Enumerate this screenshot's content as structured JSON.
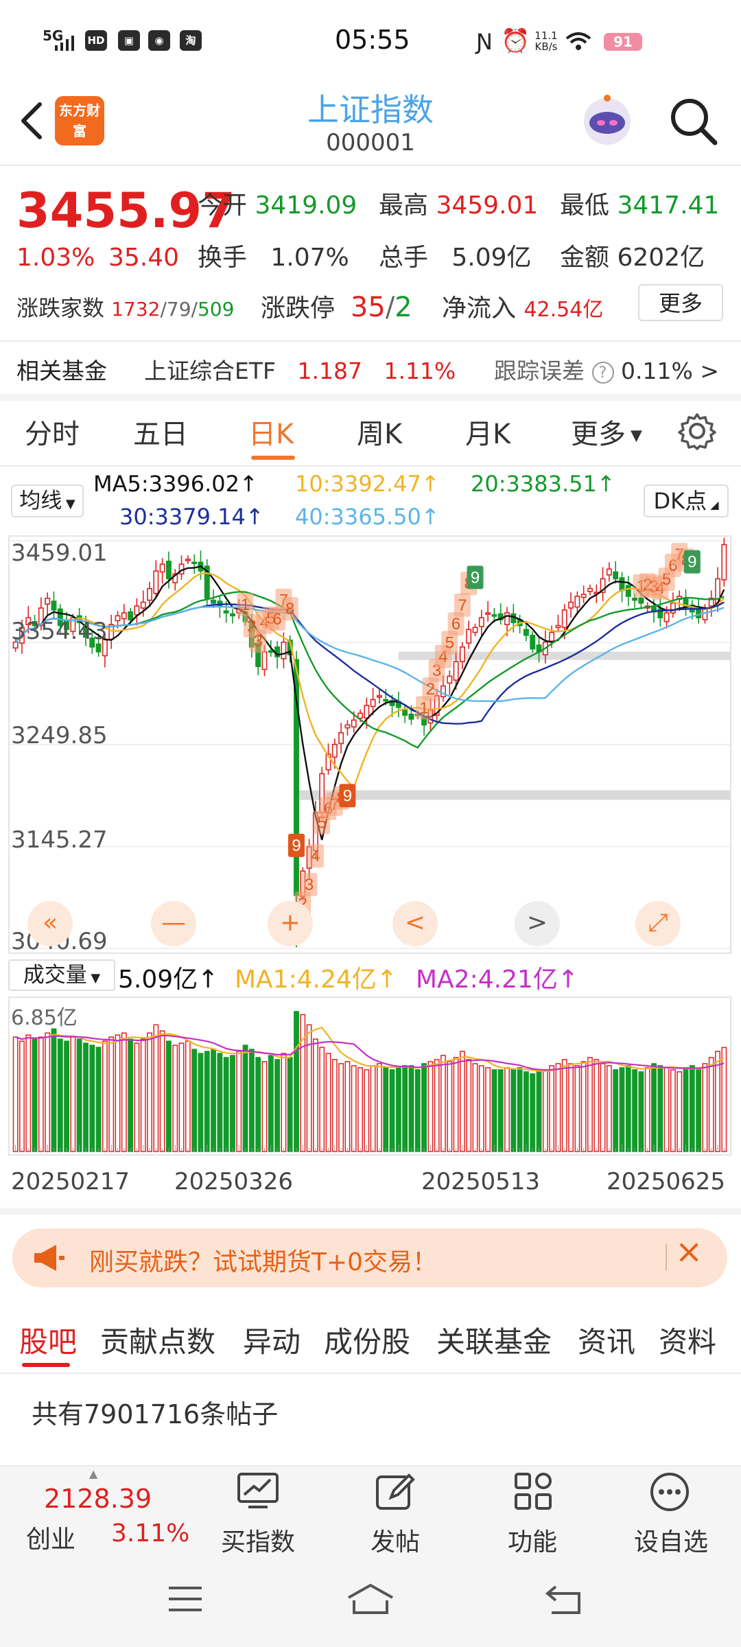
{
  "status_bar": {
    "network": "5G",
    "icons": [
      "hd-icon",
      "app-icon",
      "app2-icon",
      "taobao-icon"
    ],
    "time": "05:55",
    "speed": "11.1 KB/s",
    "battery": "91"
  },
  "header": {
    "logo_text": "东方财富",
    "title": "上证指数",
    "code": "000001"
  },
  "quote": {
    "price": "3455.97",
    "change_pct": "1.03%",
    "change_abs": "35.40",
    "open_label": "今开",
    "open": "3419.09",
    "high_label": "最高",
    "high": "3459.01",
    "low_label": "最低",
    "low": "3417.41",
    "turnover_label": "换手",
    "turnover": "1.07%",
    "volume_label": "总手",
    "volume": "5.09亿",
    "amount_label": "金额",
    "amount": "6202亿",
    "breadth_label": "涨跌家数",
    "breadth_up": "1732",
    "breadth_sep1": "/",
    "breadth_flat": "79",
    "breadth_sep2": "/",
    "breadth_down": "509",
    "limit_label": "涨跌停",
    "limit_up": "35",
    "limit_sep": "/",
    "limit_down": "2",
    "netflow_label": "净流入",
    "netflow": "42.54亿",
    "more_label": "更多"
  },
  "fund": {
    "label": "相关基金",
    "name": "上证综合ETF",
    "price": "1.187",
    "pct": "1.11%",
    "track_label": "跟踪误差",
    "track_value": "0.11%",
    "arrow": ">"
  },
  "period_tabs": [
    "分时",
    "五日",
    "日K",
    "周K",
    "月K",
    "更多"
  ],
  "active_period": "日K",
  "ma_legend": {
    "select_label": "均线",
    "ma5": "MA5:3396.02↑",
    "ma10": "10:3392.47↑",
    "ma20": "20:3383.51↑",
    "ma30": "30:3379.14↑",
    "ma40": "40:3365.50↑",
    "dk_label": "DK点"
  },
  "colors": {
    "up": "#e02020",
    "down": "#129a2a",
    "ma5": "#111111",
    "ma10": "#f0b323",
    "ma20": "#129a2a",
    "ma30": "#1c2f9c",
    "ma40": "#5ab4ea",
    "accent": "#f0762a"
  },
  "volume_legend": {
    "select_label": "成交量",
    "vol": "5.09亿↑",
    "ma1": "MA1:4.24亿↑",
    "ma2": "MA2:4.21亿↑",
    "axis_max": "6.85亿"
  },
  "chart_data": {
    "type": "candlestick",
    "y_ticks": [
      "3459.01",
      "3354.43",
      "3249.85",
      "3145.27",
      "3040.69"
    ],
    "ylim": [
      3040.69,
      3459.01
    ],
    "x_labels": [
      "20250217",
      "20250326",
      "20250513",
      "20250625"
    ],
    "closes": [
      3355,
      3370,
      3380,
      3372,
      3390,
      3400,
      3388,
      3372,
      3368,
      3380,
      3375,
      3360,
      3350,
      3345,
      3358,
      3373,
      3382,
      3385,
      3378,
      3392,
      3396,
      3410,
      3428,
      3435,
      3420,
      3425,
      3435,
      3440,
      3436,
      3428,
      3400,
      3395,
      3392,
      3385,
      3382,
      3390,
      3376,
      3350,
      3330,
      3345,
      3345,
      3340,
      3355,
      3342,
      3095,
      3120,
      3145,
      3180,
      3220,
      3240,
      3250,
      3262,
      3270,
      3275,
      3282,
      3290,
      3296,
      3300,
      3295,
      3290,
      3288,
      3280,
      3276,
      3280,
      3270,
      3285,
      3300,
      3310,
      3320,
      3335,
      3350,
      3368,
      3370,
      3380,
      3385,
      3382,
      3378,
      3385,
      3375,
      3372,
      3362,
      3348,
      3345,
      3355,
      3365,
      3372,
      3388,
      3396,
      3402,
      3404,
      3410,
      3406,
      3420,
      3430,
      3420,
      3408,
      3402,
      3398,
      3395,
      3392,
      3386,
      3380,
      3385,
      3395,
      3402,
      3392,
      3386,
      3380,
      3390,
      3400,
      3420,
      3455
    ],
    "volumes": [
      5.6,
      5.4,
      5.7,
      5.5,
      5.6,
      5.8,
      6.0,
      5.5,
      5.4,
      5.6,
      5.5,
      5.3,
      5.2,
      5.1,
      5.4,
      5.6,
      5.7,
      5.8,
      5.5,
      5.3,
      5.5,
      5.8,
      6.2,
      5.9,
      5.4,
      5.2,
      5.3,
      5.4,
      5.0,
      4.8,
      4.9,
      5.0,
      4.8,
      4.6,
      4.7,
      4.9,
      5.2,
      5.0,
      4.6,
      4.4,
      4.7,
      4.5,
      4.8,
      4.6,
      6.85,
      6.7,
      6.2,
      5.5,
      5.1,
      4.8,
      4.5,
      4.3,
      4.4,
      4.2,
      4.1,
      4.0,
      4.2,
      4.3,
      4.1,
      4.0,
      4.1,
      4.2,
      4.2,
      4.0,
      4.3,
      4.4,
      4.5,
      4.7,
      4.4,
      4.6,
      4.9,
      4.5,
      4.3,
      4.2,
      4.1,
      4.0,
      4.0,
      4.1,
      4.0,
      4.1,
      3.9,
      3.8,
      3.9,
      4.0,
      4.2,
      4.3,
      4.5,
      4.3,
      4.2,
      4.4,
      4.6,
      4.5,
      4.3,
      4.2,
      4.0,
      4.1,
      4.2,
      4.0,
      3.9,
      4.1,
      4.3,
      4.2,
      4.1,
      4.0,
      3.9,
      4.1,
      4.2,
      4.0,
      4.3,
      4.6,
      4.9,
      5.09
    ],
    "nine_turn_labels": [
      "1",
      "2",
      "3",
      "4",
      "5",
      "6",
      "7",
      "8",
      "9"
    ]
  },
  "chart_controls": [
    "«",
    "—",
    "+",
    "<",
    ">",
    "⤢"
  ],
  "promo": {
    "text": "刚买就跌？试试期货T+0交易！",
    "close": "×"
  },
  "forum_tabs": [
    "股吧",
    "贡献点数",
    "异动",
    "成份股",
    "关联基金",
    "资讯",
    "资料"
  ],
  "posts": {
    "text": "共有7901716条帖子"
  },
  "bottom_bar": {
    "index_value": "2128.39",
    "index_name": "创业",
    "index_pct": "3.11%",
    "buy_label": "买指数",
    "post_label": "发帖",
    "func_label": "功能",
    "watch_label": "设自选"
  }
}
